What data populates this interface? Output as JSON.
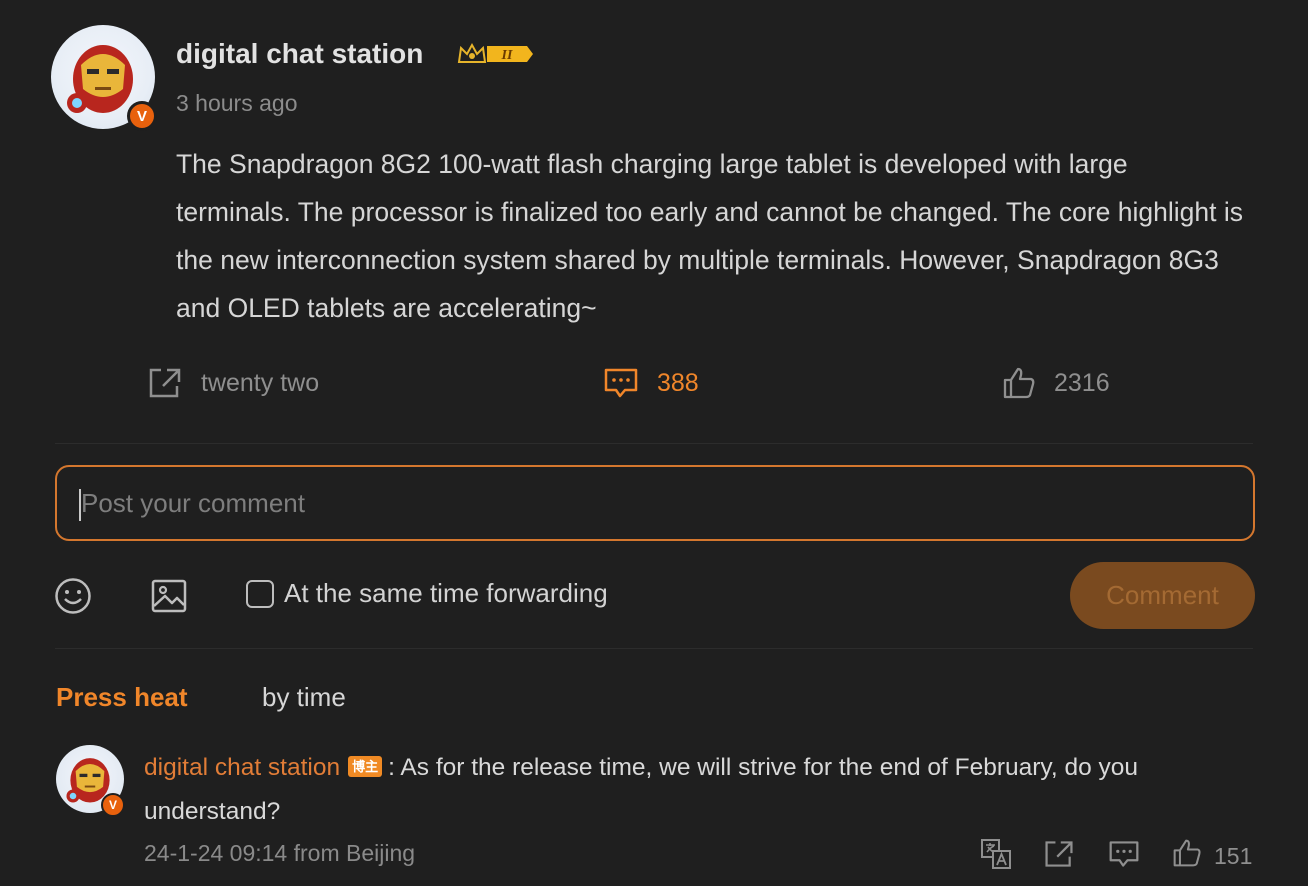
{
  "post": {
    "author": "digital chat station",
    "level_badge": "II",
    "verified_badge": "V",
    "timestamp": "3 hours ago",
    "text": "The Snapdragon 8G2 100-watt flash charging large tablet is developed with large terminals. The processor is finalized too early and cannot be changed. The core highlight is the new interconnection system shared by multiple terminals. However, Snapdragon 8G3 and OLED tablets are accelerating~",
    "actions": {
      "forward_count": "twenty two",
      "comment_count": "388",
      "like_count": "2316"
    }
  },
  "composer": {
    "placeholder": "Post your comment",
    "forward_checkbox_label": "At the same time forwarding",
    "submit_label": "Comment"
  },
  "sort": {
    "hot_label": "Press heat",
    "time_label": "by time"
  },
  "comments": [
    {
      "author": "digital chat station",
      "owner_tag": "博主",
      "verified_badge": "V",
      "separator": ":",
      "text": "As for the release time, we will strive for the end of February, do you understand?",
      "meta": "24-1-24 09:14 from Beijing",
      "like_count": "151"
    }
  ],
  "colors": {
    "background": "#1f1f1f",
    "accent": "#f0862a",
    "muted": "#8c8c8c",
    "submit_bg": "#7a4a1f"
  },
  "icons": [
    "verified-icon",
    "crown-level-icon",
    "forward-icon",
    "comment-icon",
    "like-icon",
    "emoji-icon",
    "image-icon",
    "translate-icon"
  ]
}
